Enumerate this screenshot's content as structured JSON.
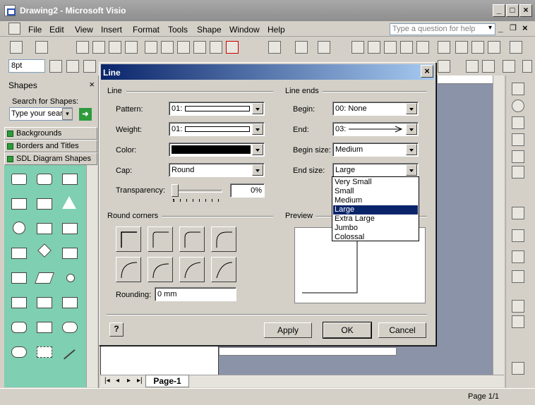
{
  "window": {
    "title": "Drawing2 - Microsoft Visio"
  },
  "menubar": {
    "items": [
      "File",
      "Edit",
      "View",
      "Insert",
      "Format",
      "Tools",
      "Shape",
      "Window",
      "Help"
    ],
    "help_placeholder": "Type a question for help"
  },
  "format_toolbar": {
    "font_size": "8pt"
  },
  "shapes_panel": {
    "title": "Shapes",
    "search_label": "Search for Shapes:",
    "search_value": "Type your sear",
    "stencils": [
      "Backgrounds",
      "Borders and Titles",
      "SDL Diagram Shapes"
    ]
  },
  "page_tab": {
    "label": "Page-1"
  },
  "statusbar": {
    "page_info": "Page 1/1"
  },
  "dialog": {
    "title": "Line",
    "line_group": "Line",
    "line_ends_group": "Line ends",
    "round_corners_group": "Round corners",
    "preview_group": "Preview",
    "pattern": {
      "label": "Pattern:",
      "value": "01:"
    },
    "weight": {
      "label": "Weight:",
      "value": "01:"
    },
    "color": {
      "label": "Color:"
    },
    "cap": {
      "label": "Cap:",
      "value": "Round"
    },
    "transparency": {
      "label": "Transparency:",
      "value": "0%",
      "level": 0
    },
    "begin": {
      "label": "Begin:",
      "value": "00: None"
    },
    "end": {
      "label": "End:",
      "value": "03:"
    },
    "begin_size": {
      "label": "Begin size:",
      "value": "Medium"
    },
    "end_size": {
      "label": "End size:",
      "value": "Large"
    },
    "rounding": {
      "label": "Rounding:",
      "value": "0 mm"
    },
    "end_size_options": [
      "Very Small",
      "Small",
      "Medium",
      "Large",
      "Extra Large",
      "Jumbo",
      "Colossal"
    ],
    "end_size_selected_index": 3,
    "buttons": {
      "apply": "Apply",
      "ok": "OK",
      "cancel": "Cancel"
    },
    "colors": {
      "title_start": "#0a246a",
      "title_end": "#a6caf0",
      "line_color": "#000000"
    }
  }
}
